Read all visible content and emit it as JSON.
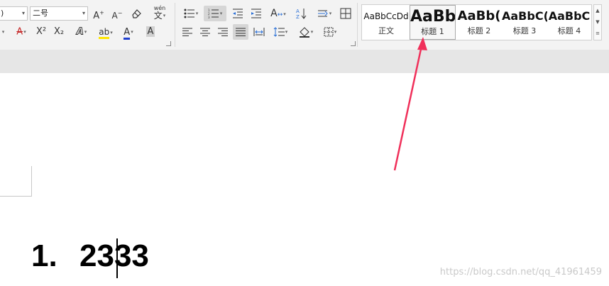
{
  "font": {
    "name_value": ")",
    "size_value": "二号",
    "grow_icon": "grow-font",
    "shrink_icon": "shrink-font",
    "clear_icon": "clear-formatting",
    "phonetic_label": "wén",
    "phonetic_char": "文",
    "strikethrough_label": "A",
    "superscript_label": "X²",
    "subscript_label": "X₂",
    "text_effect_label": "A",
    "highlight_label": "ab",
    "font_color_label": "A",
    "char_shade_label": "A",
    "highlight_color": "#ffe600",
    "font_color": "#1f3fcf"
  },
  "paragraph": {
    "bullets_icon": "bullet-list",
    "numbering_icon": "numbered-list",
    "decrease_indent_icon": "decrease-indent",
    "increase_indent_icon": "increase-indent",
    "chinese_layout_icon": "chinese-layout",
    "sort_icon": "sort-az",
    "show_marks_icon": "show-marks",
    "align_left_icon": "align-left",
    "align_center_icon": "align-center",
    "align_right_icon": "align-right",
    "justify_icon": "justify",
    "distribute_icon": "distribute",
    "line_spacing_icon": "line-spacing",
    "shading_icon": "shading",
    "borders_icon": "borders"
  },
  "styles": {
    "items": [
      {
        "sample": "AaBbCcDd",
        "label": "正文"
      },
      {
        "sample": "AaBb",
        "label": "标题 1"
      },
      {
        "sample": "AaBb(",
        "label": "标题 2"
      },
      {
        "sample": "AaBbC(",
        "label": "标题 3"
      },
      {
        "sample": "AaBbC",
        "label": "标题 4"
      }
    ],
    "selected_index": 1
  },
  "document": {
    "list_number": "1.",
    "heading_text": "2333"
  },
  "watermark": "https://blog.csdn.net/qq_41961459",
  "annotation": {
    "arrow_color": "#f0305a"
  }
}
